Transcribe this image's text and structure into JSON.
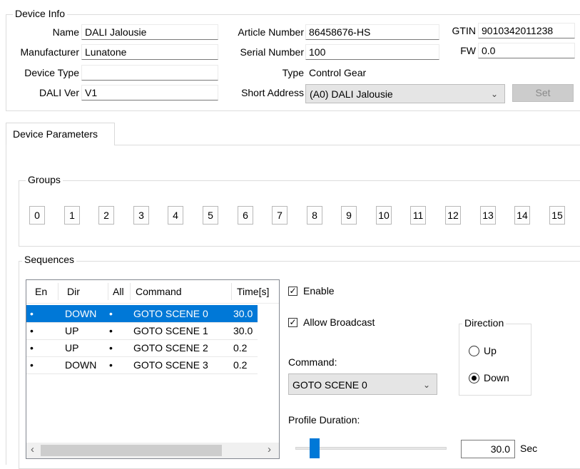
{
  "device_info": {
    "title": "Device Info",
    "name_label": "Name",
    "name_value": "DALI Jalousie",
    "manufacturer_label": "Manufacturer",
    "manufacturer_value": "Lunatone",
    "device_type_label": "Device Type",
    "device_type_value": "",
    "dali_ver_label": "DALI Ver",
    "dali_ver_value": "V1",
    "article_number_label": "Article Number",
    "article_number_value": "86458676-HS",
    "serial_number_label": "Serial Number",
    "serial_number_value": "100",
    "type_label": "Type",
    "type_value": "Control Gear",
    "short_address_label": "Short Address",
    "short_address_value": "(A0) DALI Jalousie",
    "gtin_label": "GTIN",
    "gtin_value": "9010342011238",
    "fw_label": "FW",
    "fw_value": "0.0",
    "set_label": "Set"
  },
  "tabs": [
    {
      "label": "Device Parameters",
      "active": true
    }
  ],
  "groups": {
    "title": "Groups",
    "buttons": [
      "0",
      "1",
      "2",
      "3",
      "4",
      "5",
      "6",
      "7",
      "8",
      "9",
      "10",
      "11",
      "12",
      "13",
      "14",
      "15"
    ]
  },
  "sequences": {
    "title": "Sequences",
    "columns": [
      "En",
      "Dir",
      "All",
      "Command",
      "Time[s]"
    ],
    "rows": [
      {
        "en": "•",
        "dir": "DOWN",
        "all": "•",
        "command": "GOTO SCENE 0",
        "time": "30.0",
        "selected": true
      },
      {
        "en": "•",
        "dir": "UP",
        "all": "•",
        "command": "GOTO SCENE 1",
        "time": "30.0",
        "selected": false
      },
      {
        "en": "•",
        "dir": "UP",
        "all": "•",
        "command": "GOTO SCENE 2",
        "time": "0.2",
        "selected": false
      },
      {
        "en": "•",
        "dir": "DOWN",
        "all": "•",
        "command": "GOTO SCENE 3",
        "time": "0.2",
        "selected": false
      }
    ],
    "scroll_left_icon": "chevron-left-icon",
    "scroll_right_icon": "chevron-right-icon",
    "enable_label": "Enable",
    "enable_checked": true,
    "allow_broadcast_label": "Allow Broadcast",
    "allow_broadcast_checked": true,
    "command_label": "Command:",
    "command_value": "GOTO SCENE 0",
    "direction_title": "Direction",
    "direction_up_label": "Up",
    "direction_down_label": "Down",
    "direction_selected": "Down",
    "profile_duration_label": "Profile Duration:",
    "profile_duration_value": "30.0",
    "profile_duration_unit": "Sec"
  },
  "colors": {
    "selection": "#0078d7",
    "slider_thumb": "#0078d7",
    "disabled_button": "#cccccc"
  }
}
